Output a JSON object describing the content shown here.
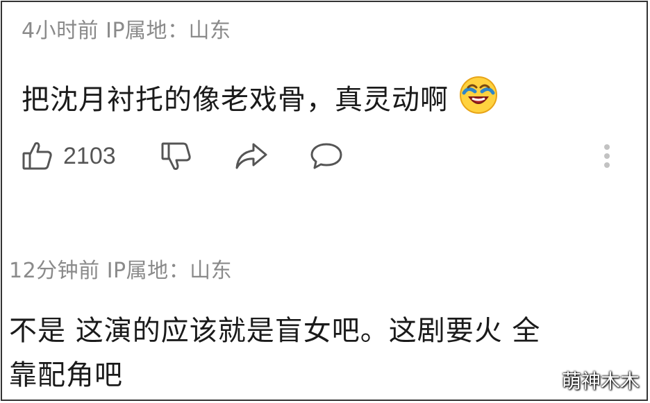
{
  "comments": [
    {
      "meta": "4小时前 IP属地：山东",
      "text": "把沈月衬托的像老戏骨，真灵动啊",
      "emoji": "laughing-crying-emoji",
      "likes": "2103"
    },
    {
      "meta": "12分钟前 IP属地：山东",
      "text_line1": "不是 这演的应该就是盲女吧。这剧要火 全",
      "text_line2": "靠配角吧"
    }
  ],
  "watermark": "萌神木木",
  "icons": {
    "like": "thumbs-up-icon",
    "dislike": "thumbs-down-icon",
    "share": "share-arrow-icon",
    "reply": "comment-bubble-icon",
    "more": "more-vertical-icon"
  },
  "colors": {
    "meta": "#8a8a8a",
    "text": "#1a1a1a",
    "icon": "#555555"
  }
}
